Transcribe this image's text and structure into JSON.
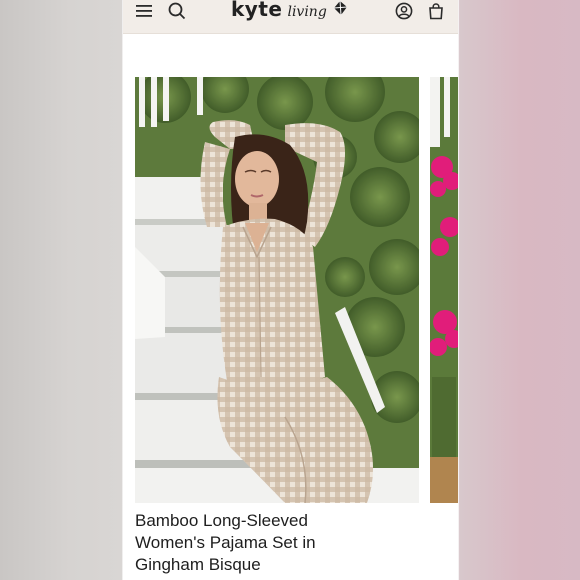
{
  "header": {
    "brand_main": "kyte",
    "brand_script": "living",
    "menu_icon": "hamburger-menu-icon",
    "search_icon": "search-icon",
    "account_icon": "account-icon",
    "cart_icon": "shopping-bag-icon"
  },
  "product": {
    "title_line1": "Bamboo Long-Sleeved",
    "title_line2": "Women's Pajama Set in",
    "title_line3": "Gingham Bisque"
  },
  "colors": {
    "header_bg": "#f2ede8",
    "gingham": "#c9b7a3",
    "foliage": "#5f7c3d",
    "flowers": "#e3247f"
  }
}
